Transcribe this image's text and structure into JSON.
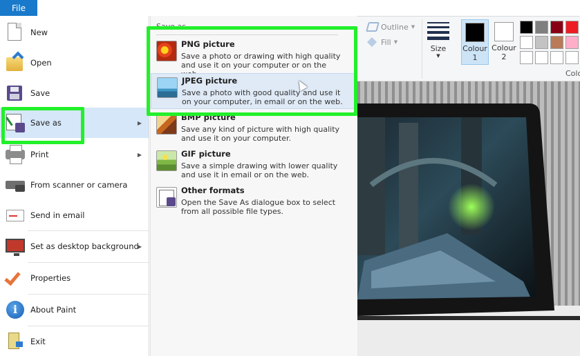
{
  "file_tab": {
    "label": "File"
  },
  "menu": {
    "items": [
      {
        "label": "New",
        "icon": "new-document-icon"
      },
      {
        "label": "Open",
        "icon": "open-folder-icon"
      },
      {
        "label": "Save",
        "icon": "save-floppy-icon"
      },
      {
        "label": "Save as",
        "icon": "save-as-icon",
        "has_submenu": true,
        "active": true
      },
      {
        "label": "Print",
        "icon": "printer-icon",
        "has_submenu": true
      },
      {
        "label": "From scanner or camera",
        "icon": "scanner-icon"
      },
      {
        "label": "Send in email",
        "icon": "email-icon"
      },
      {
        "label": "Set as desktop background",
        "icon": "desktop-background-icon",
        "has_submenu": true
      },
      {
        "label": "Properties",
        "icon": "properties-check-icon"
      },
      {
        "label": "About Paint",
        "icon": "info-icon"
      },
      {
        "label": "Exit",
        "icon": "exit-icon"
      }
    ]
  },
  "submenu": {
    "title": "Save as",
    "items": [
      {
        "title": "PNG picture",
        "description": "Save a photo or drawing with high quality and use it on your computer or on the web."
      },
      {
        "title": "JPEG picture",
        "description": "Save a photo with good quality and use it on your computer, in email or on the web."
      },
      {
        "title": "BMP picture",
        "description": "Save any kind of picture with high quality and use it on your computer."
      },
      {
        "title": "GIF picture",
        "description": "Save a simple drawing with lower quality and use it in email or on the web."
      },
      {
        "title": "Other formats",
        "description": "Open the Save As dialogue box to select from all possible file types."
      }
    ]
  },
  "ribbon": {
    "outline_label": "Outline",
    "fill_label": "Fill",
    "size_label": "Size",
    "colour1_label": "Colour 1",
    "colour2_label": "Colour 2",
    "colours_label": "Colo",
    "colour1_value": "#000000",
    "colour2_value": "#ffffff",
    "palette": [
      "#000000",
      "#7f7f7f",
      "#880015",
      "#ed1c24",
      "#ffffff",
      "#c3c3c3",
      "#b97a57",
      "#ffaec9",
      "#ffffff",
      "#ffffff",
      "#ffffff",
      "#ffffff"
    ]
  },
  "highlight_color": "#22f02a"
}
